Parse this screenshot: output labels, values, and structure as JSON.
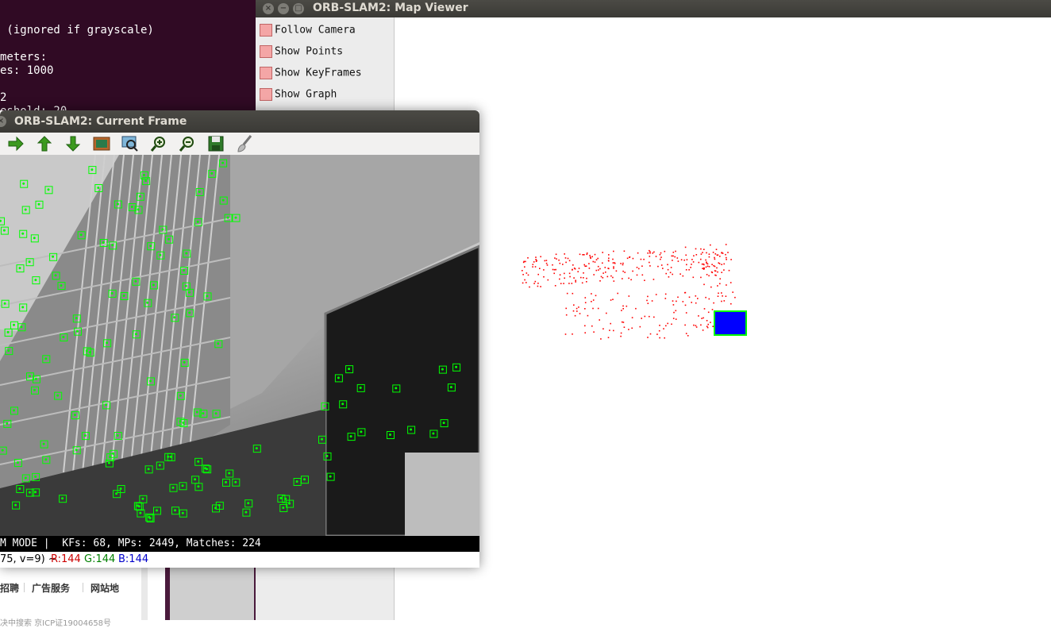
{
  "terminal": {
    "lines": [
      " (ignored if grayscale)",
      "",
      "meters:",
      "es: 1000",
      "",
      "2",
      "eshold: 20"
    ]
  },
  "webpage": {
    "links": [
      "招聘",
      "广告服务",
      "网站地"
    ],
    "footer": "决中搜索 京ICP证19004658号"
  },
  "map_viewer": {
    "title": "ORB-SLAM2: Map Viewer",
    "panel_items": [
      "Follow Camera",
      "Show Points",
      "Show KeyFrames",
      "Show Graph"
    ],
    "colors": {
      "points": "#ff0000",
      "keyframe": "#0000ff",
      "current_camera": "#00ff00"
    }
  },
  "current_frame": {
    "title": "ORB-SLAM2: Current Frame",
    "toolbar": [
      "arrow-right-icon",
      "arrow-up-icon",
      "arrow-down-icon",
      "image-icon",
      "zoom-fit-icon",
      "zoom-in-icon",
      "zoom-out-icon",
      "save-icon",
      "brush-icon"
    ],
    "status": "M MODE |  KFs: 68, MPs: 2449, Matches: 224",
    "pixel_info": {
      "coords": "75, v=9) ~",
      "r": "R:144",
      "g": "G:144",
      "b": "B:144"
    }
  }
}
